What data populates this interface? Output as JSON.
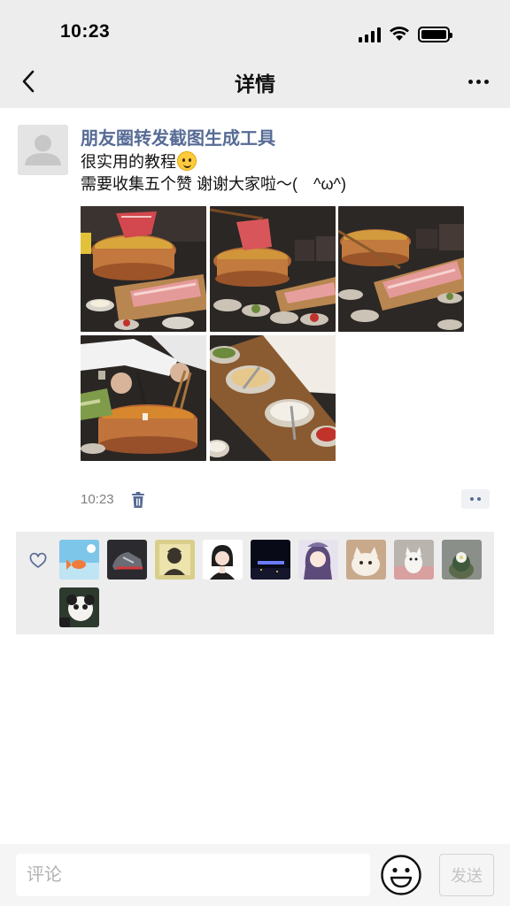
{
  "status_bar": {
    "time": "10:23"
  },
  "nav": {
    "title": "详情",
    "back_icon": "chevron-left-icon",
    "more_icon": "more-dots-icon"
  },
  "post": {
    "username": "朋友圈转发截图生成工具",
    "text_line1": "很实用的教程",
    "text_line2": "需要收集五个赞 谢谢大家啦～(　^ω^)",
    "photos": [
      "hotpot-photo-1",
      "hotpot-photo-2",
      "hotpot-photo-3",
      "hotpot-photo-4",
      "hotpot-photo-5"
    ],
    "time": "10:23"
  },
  "likes": {
    "icon": "heart-outline-icon",
    "avatars": [
      "sky-fish",
      "sneaker",
      "beethoven",
      "anime-girl",
      "night-city",
      "anime-purple-hair",
      "cat",
      "white-dog",
      "cactus",
      "panda-dog"
    ]
  },
  "comment_bar": {
    "placeholder": "评论",
    "send_label": "发送"
  },
  "colors": {
    "link": "#576b95",
    "panel": "#ededed",
    "accent_orange": "#c86a2d"
  }
}
